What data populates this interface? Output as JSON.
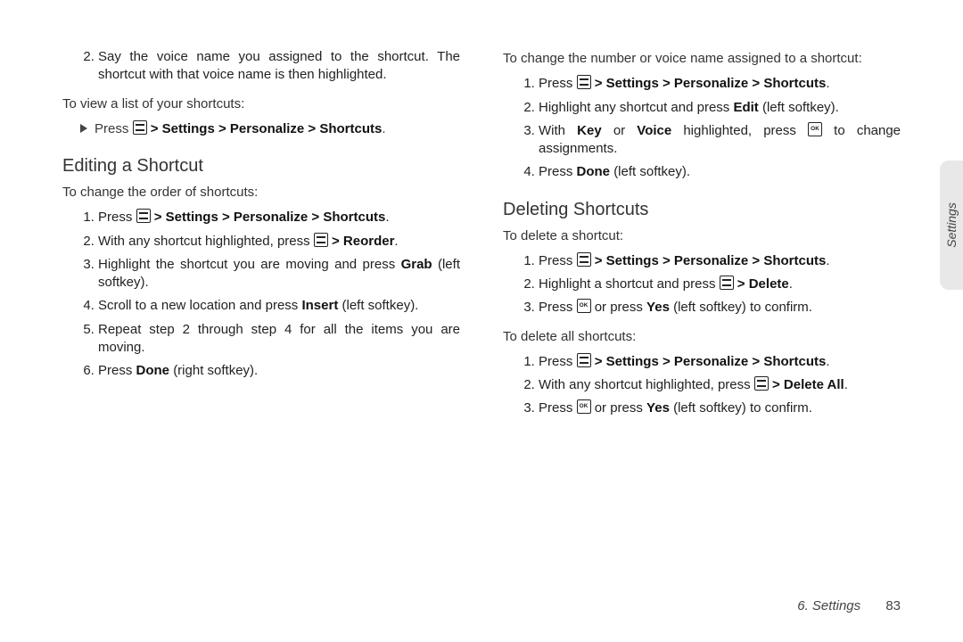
{
  "step2_top": "Say the voice name you assigned to the shortcut. The shortcut with that voice name is then highlighted.",
  "view_list_lead": "To view a list of your shortcuts:",
  "press_word": "Press ",
  "menu_path_bold": " > Settings > Personalize > Shortcuts",
  "period": ".",
  "heading_edit": "Editing a Shortcut",
  "change_order_lead": "To change the order of shortcuts:",
  "edit_steps": {
    "s1_pre": "Press ",
    "s2_pre": "With any shortcut highlighted, press ",
    "s2_bold": " > Reorder",
    "s3_a": "Highlight the shortcut you are moving and press ",
    "s3_bold": "Grab",
    "s3_b": " (left softkey).",
    "s4_a": "Scroll to a new location and press ",
    "s4_bold": "Insert",
    "s4_b": " (left softkey).",
    "s5": "Repeat step 2 through step 4 for all the items you are moving.",
    "s6_a": "Press ",
    "s6_bold": "Done",
    "s6_b": " (right softkey)."
  },
  "change_num_lead": "To change the number or voice name assigned to a shortcut:",
  "num_steps": {
    "s2_a": "Highlight any shortcut and press ",
    "s2_bold": "Edit",
    "s2_b": " (left softkey).",
    "s3_a": "With ",
    "s3_bold1": "Key",
    "s3_mid": " or ",
    "s3_bold2": "Voice",
    "s3_b": " highlighted, press ",
    "s3_c": " to change assignments.",
    "s4_a": "Press ",
    "s4_bold": "Done",
    "s4_b": " (left softkey)."
  },
  "heading_delete": "Deleting Shortcuts",
  "delete_one_lead": "To delete a shortcut:",
  "del_steps": {
    "s2_a": "Highlight a shortcut and press ",
    "s2_bold": " > Delete",
    "s3_a": "Press ",
    "s3_b": " or press ",
    "s3_bold": "Yes",
    "s3_c": " (left softkey) to confirm."
  },
  "delete_all_lead": "To delete all shortcuts:",
  "delall_steps": {
    "s2_a": "With any shortcut highlighted, press ",
    "s2_bold": " > Delete All"
  },
  "side_tab": "Settings",
  "footer_section": "6. Settings",
  "footer_page": "83"
}
